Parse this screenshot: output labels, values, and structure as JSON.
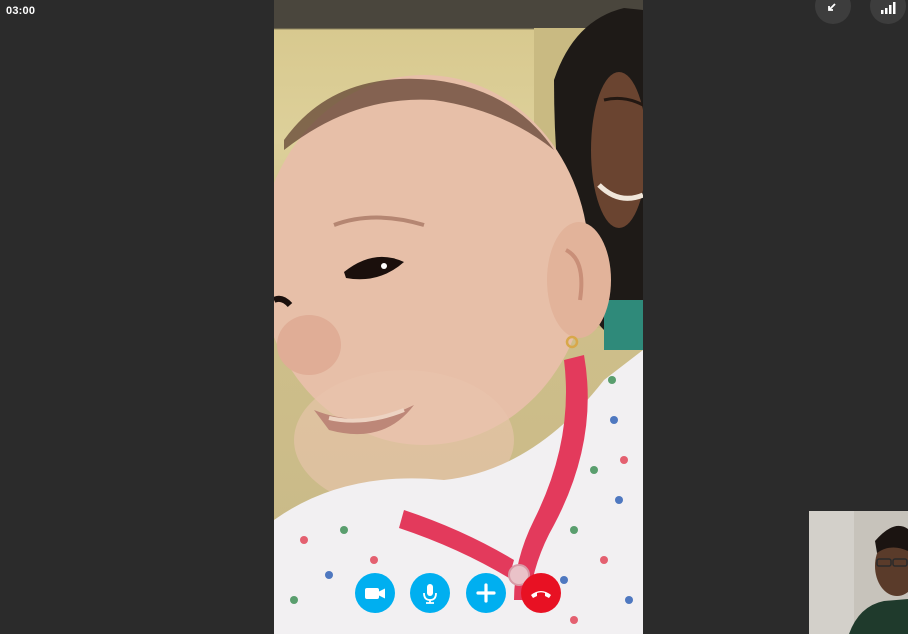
{
  "call": {
    "timer": "03:00"
  },
  "top_controls": {
    "icons": [
      "minimize-icon",
      "signal-strength-icon"
    ]
  },
  "controls": {
    "icons": [
      "video-camera-icon",
      "microphone-icon",
      "add-icon",
      "end-call-icon"
    ],
    "colors": {
      "primary": "#00aff0",
      "end_call": "#e81123"
    }
  },
  "theme": {
    "background": "#2b2b2b"
  }
}
